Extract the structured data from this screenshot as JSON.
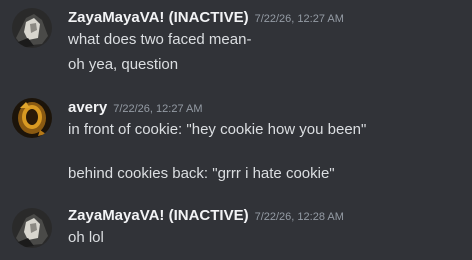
{
  "messages": [
    {
      "username": "ZayaMayaVA! (INACTIVE)",
      "timestamp": "7/22/26, 12:27 AM",
      "avatar_icon": "avatar-dark-figure-icon",
      "lines": [
        "what does two faced mean-",
        "oh yea, question"
      ]
    },
    {
      "username": "avery",
      "timestamp": "7/22/26, 12:27 AM",
      "avatar_icon": "avatar-golden-figure-icon",
      "lines": [
        "in front of cookie: \"hey cookie how you been\"",
        "",
        "behind cookies back: \"grrr i hate cookie\""
      ]
    },
    {
      "username": "ZayaMayaVA! (INACTIVE)",
      "timestamp": "7/22/26, 12:28 AM",
      "avatar_icon": "avatar-dark-figure-icon",
      "lines": [
        "oh lol"
      ]
    }
  ],
  "colors": {
    "background": "#313338",
    "username": "#f2f3f5",
    "timestamp": "#949ba4",
    "text": "#dbdee1"
  }
}
